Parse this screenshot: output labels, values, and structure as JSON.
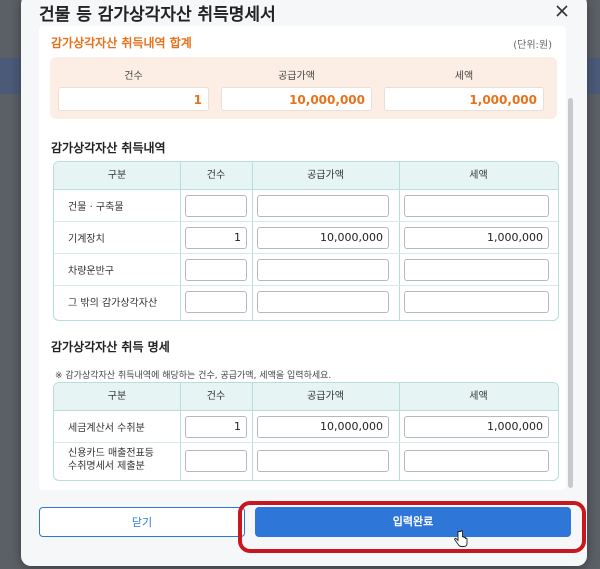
{
  "dialog": {
    "title": "건물 등 감가상각자산 취득명세서"
  },
  "summary": {
    "title": "감가상각자산 취득내역 합계",
    "unit": "(단위:원)",
    "headers": [
      "건수",
      "공급가액",
      "세액"
    ],
    "values": [
      "1",
      "10,000,000",
      "1,000,000"
    ]
  },
  "acquisition": {
    "title": "감가상각자산 취득내역",
    "headers": [
      "구분",
      "건수",
      "공급가액",
      "세액"
    ],
    "rows": [
      {
        "label": "건물 · 구축물",
        "count": "",
        "supply": "",
        "tax": ""
      },
      {
        "label": "기계장치",
        "count": "1",
        "supply": "10,000,000",
        "tax": "1,000,000"
      },
      {
        "label": "차량운반구",
        "count": "",
        "supply": "",
        "tax": ""
      },
      {
        "label": "그 밖의 감가상각자산",
        "count": "",
        "supply": "",
        "tax": ""
      }
    ]
  },
  "detail": {
    "title": "감가상각자산 취득 명세",
    "note": "※ 감가상각자산 취득내역에 해당하는 건수, 공급가액, 세액을 입력하세요.",
    "headers": [
      "구분",
      "건수",
      "공급가액",
      "세액"
    ],
    "rows": [
      {
        "label": "세금계산서 수취분",
        "count": "1",
        "supply": "10,000,000",
        "tax": "1,000,000"
      },
      {
        "label_line1": "신용카드 매출전표등",
        "label_line2": "수취명세서 제출분",
        "count": "",
        "supply": "",
        "tax": ""
      }
    ]
  },
  "footer": {
    "close_label": "닫기",
    "confirm_label": "입력완료"
  },
  "colors": {
    "accent": "#2f76d9",
    "orange": "#e8721c",
    "highlight": "#c8171f",
    "grid_head": "#e6f4f4"
  }
}
